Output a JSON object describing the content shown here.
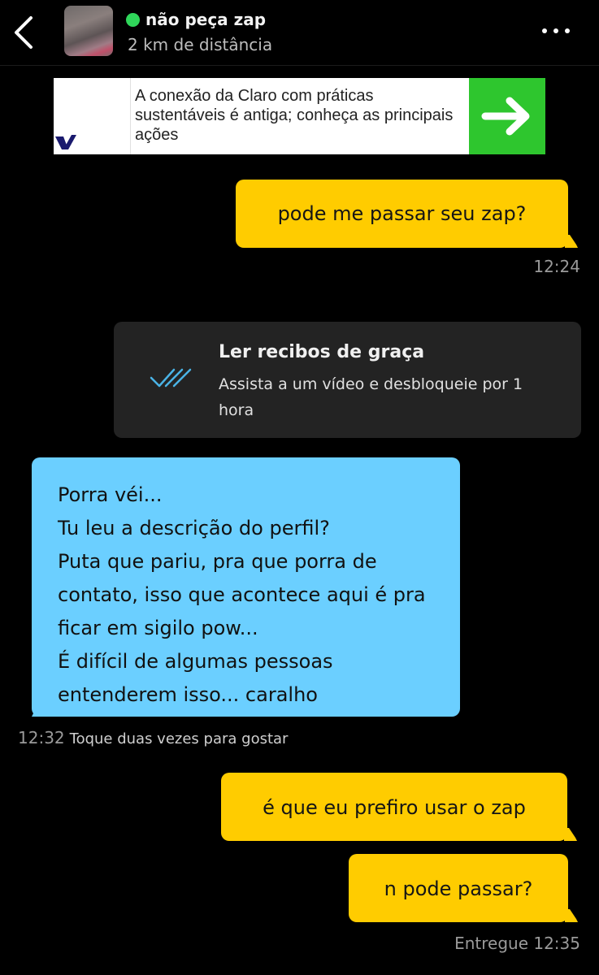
{
  "header": {
    "contact_name": "não peça zap",
    "distance": "2 km de distância",
    "status_color": "#2fd65a"
  },
  "ad": {
    "text": "A conexão da Claro com práticas sustentáveis é antiga; conheça as principais ações",
    "button_color": "#2ec62e"
  },
  "messages": [
    {
      "direction": "sent",
      "text": "pode me passar seu zap?",
      "time": "12:24"
    },
    {
      "direction": "received",
      "text": "Porra véi...\nTu leu a descrição do perfil?\nPuta que pariu, pra que porra de contato, isso que acontece aqui é pra ficar em sigilo pow...\nÉ difícil de algumas pessoas entenderem isso... caralho",
      "time": "12:32",
      "hint": "Toque duas vezes para gostar"
    },
    {
      "direction": "sent",
      "text": "é que eu prefiro usar o zap"
    },
    {
      "direction": "sent",
      "text": "n pode passar?",
      "status": "Entregue 12:35"
    }
  ],
  "read_receipts": {
    "title": "Ler recibos de graça",
    "subtitle": "Assista a um vídeo e desbloqueie por 1 hora",
    "icon": "double-check-icon"
  },
  "colors": {
    "sent_bubble": "#ffcc00",
    "received_bubble": "#6bcfff",
    "background": "#000000"
  }
}
